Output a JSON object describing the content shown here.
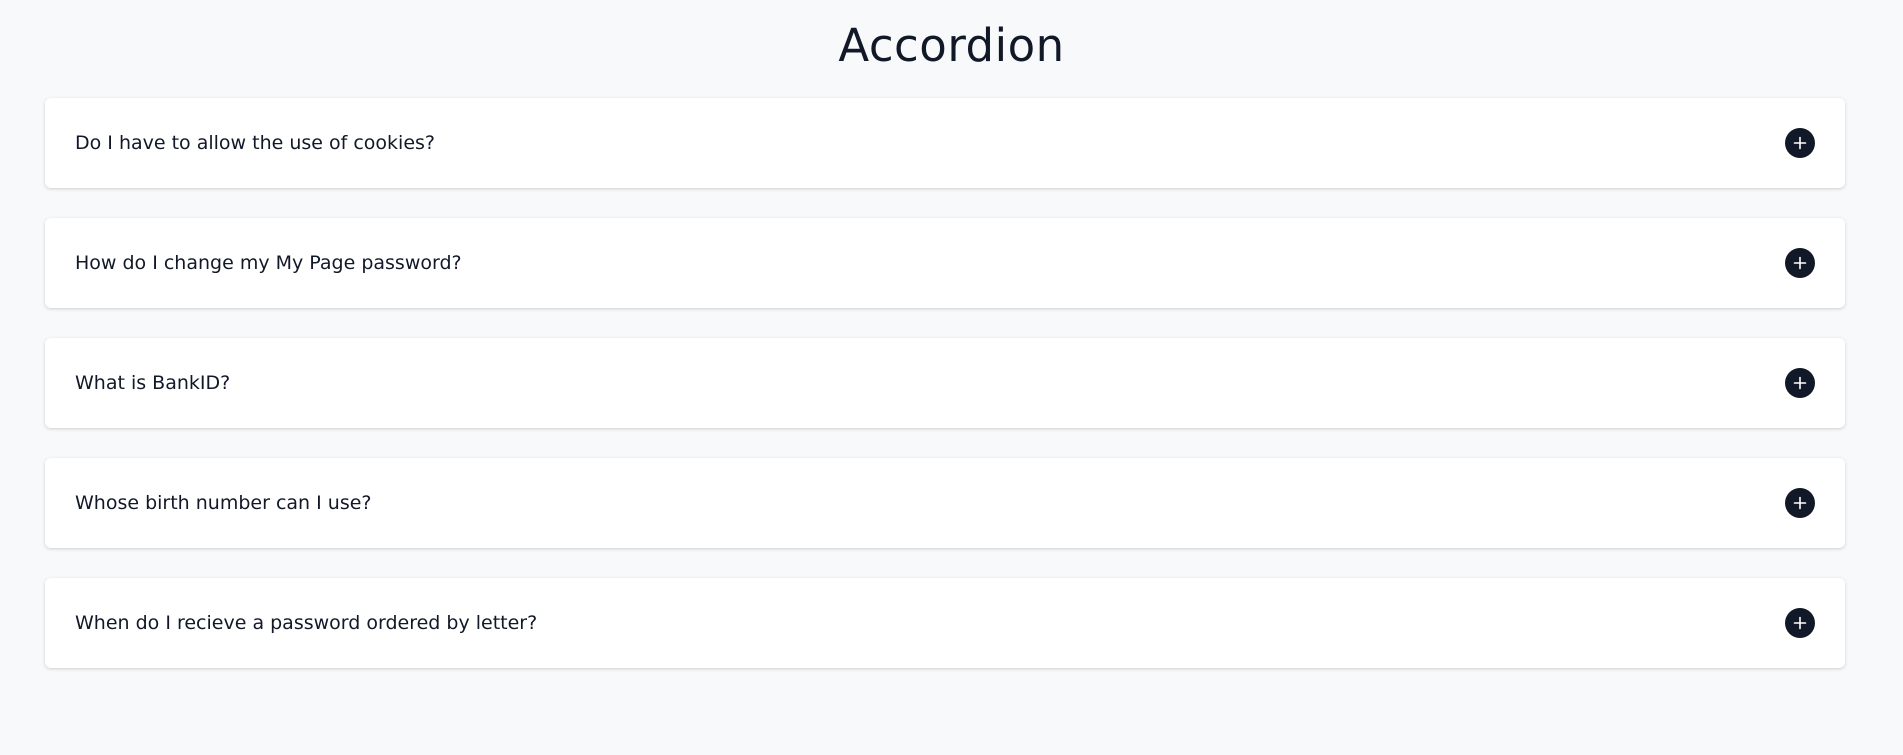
{
  "page": {
    "title": "Accordion"
  },
  "accordion": {
    "items": [
      {
        "question": "Do I have to allow the use of cookies?",
        "expanded": false
      },
      {
        "question": "How do I change my My Page password?",
        "expanded": false
      },
      {
        "question": "What is BankID?",
        "expanded": false
      },
      {
        "question": "Whose birth number can I use?",
        "expanded": false
      },
      {
        "question": "When do I recieve a password ordered by letter?",
        "expanded": false
      }
    ],
    "toggle_icon": "plus-icon"
  },
  "colors": {
    "background": "#f8f9fb",
    "card": "#ffffff",
    "text": "#111827",
    "icon_bg": "#111827",
    "icon_fg": "#ffffff"
  }
}
